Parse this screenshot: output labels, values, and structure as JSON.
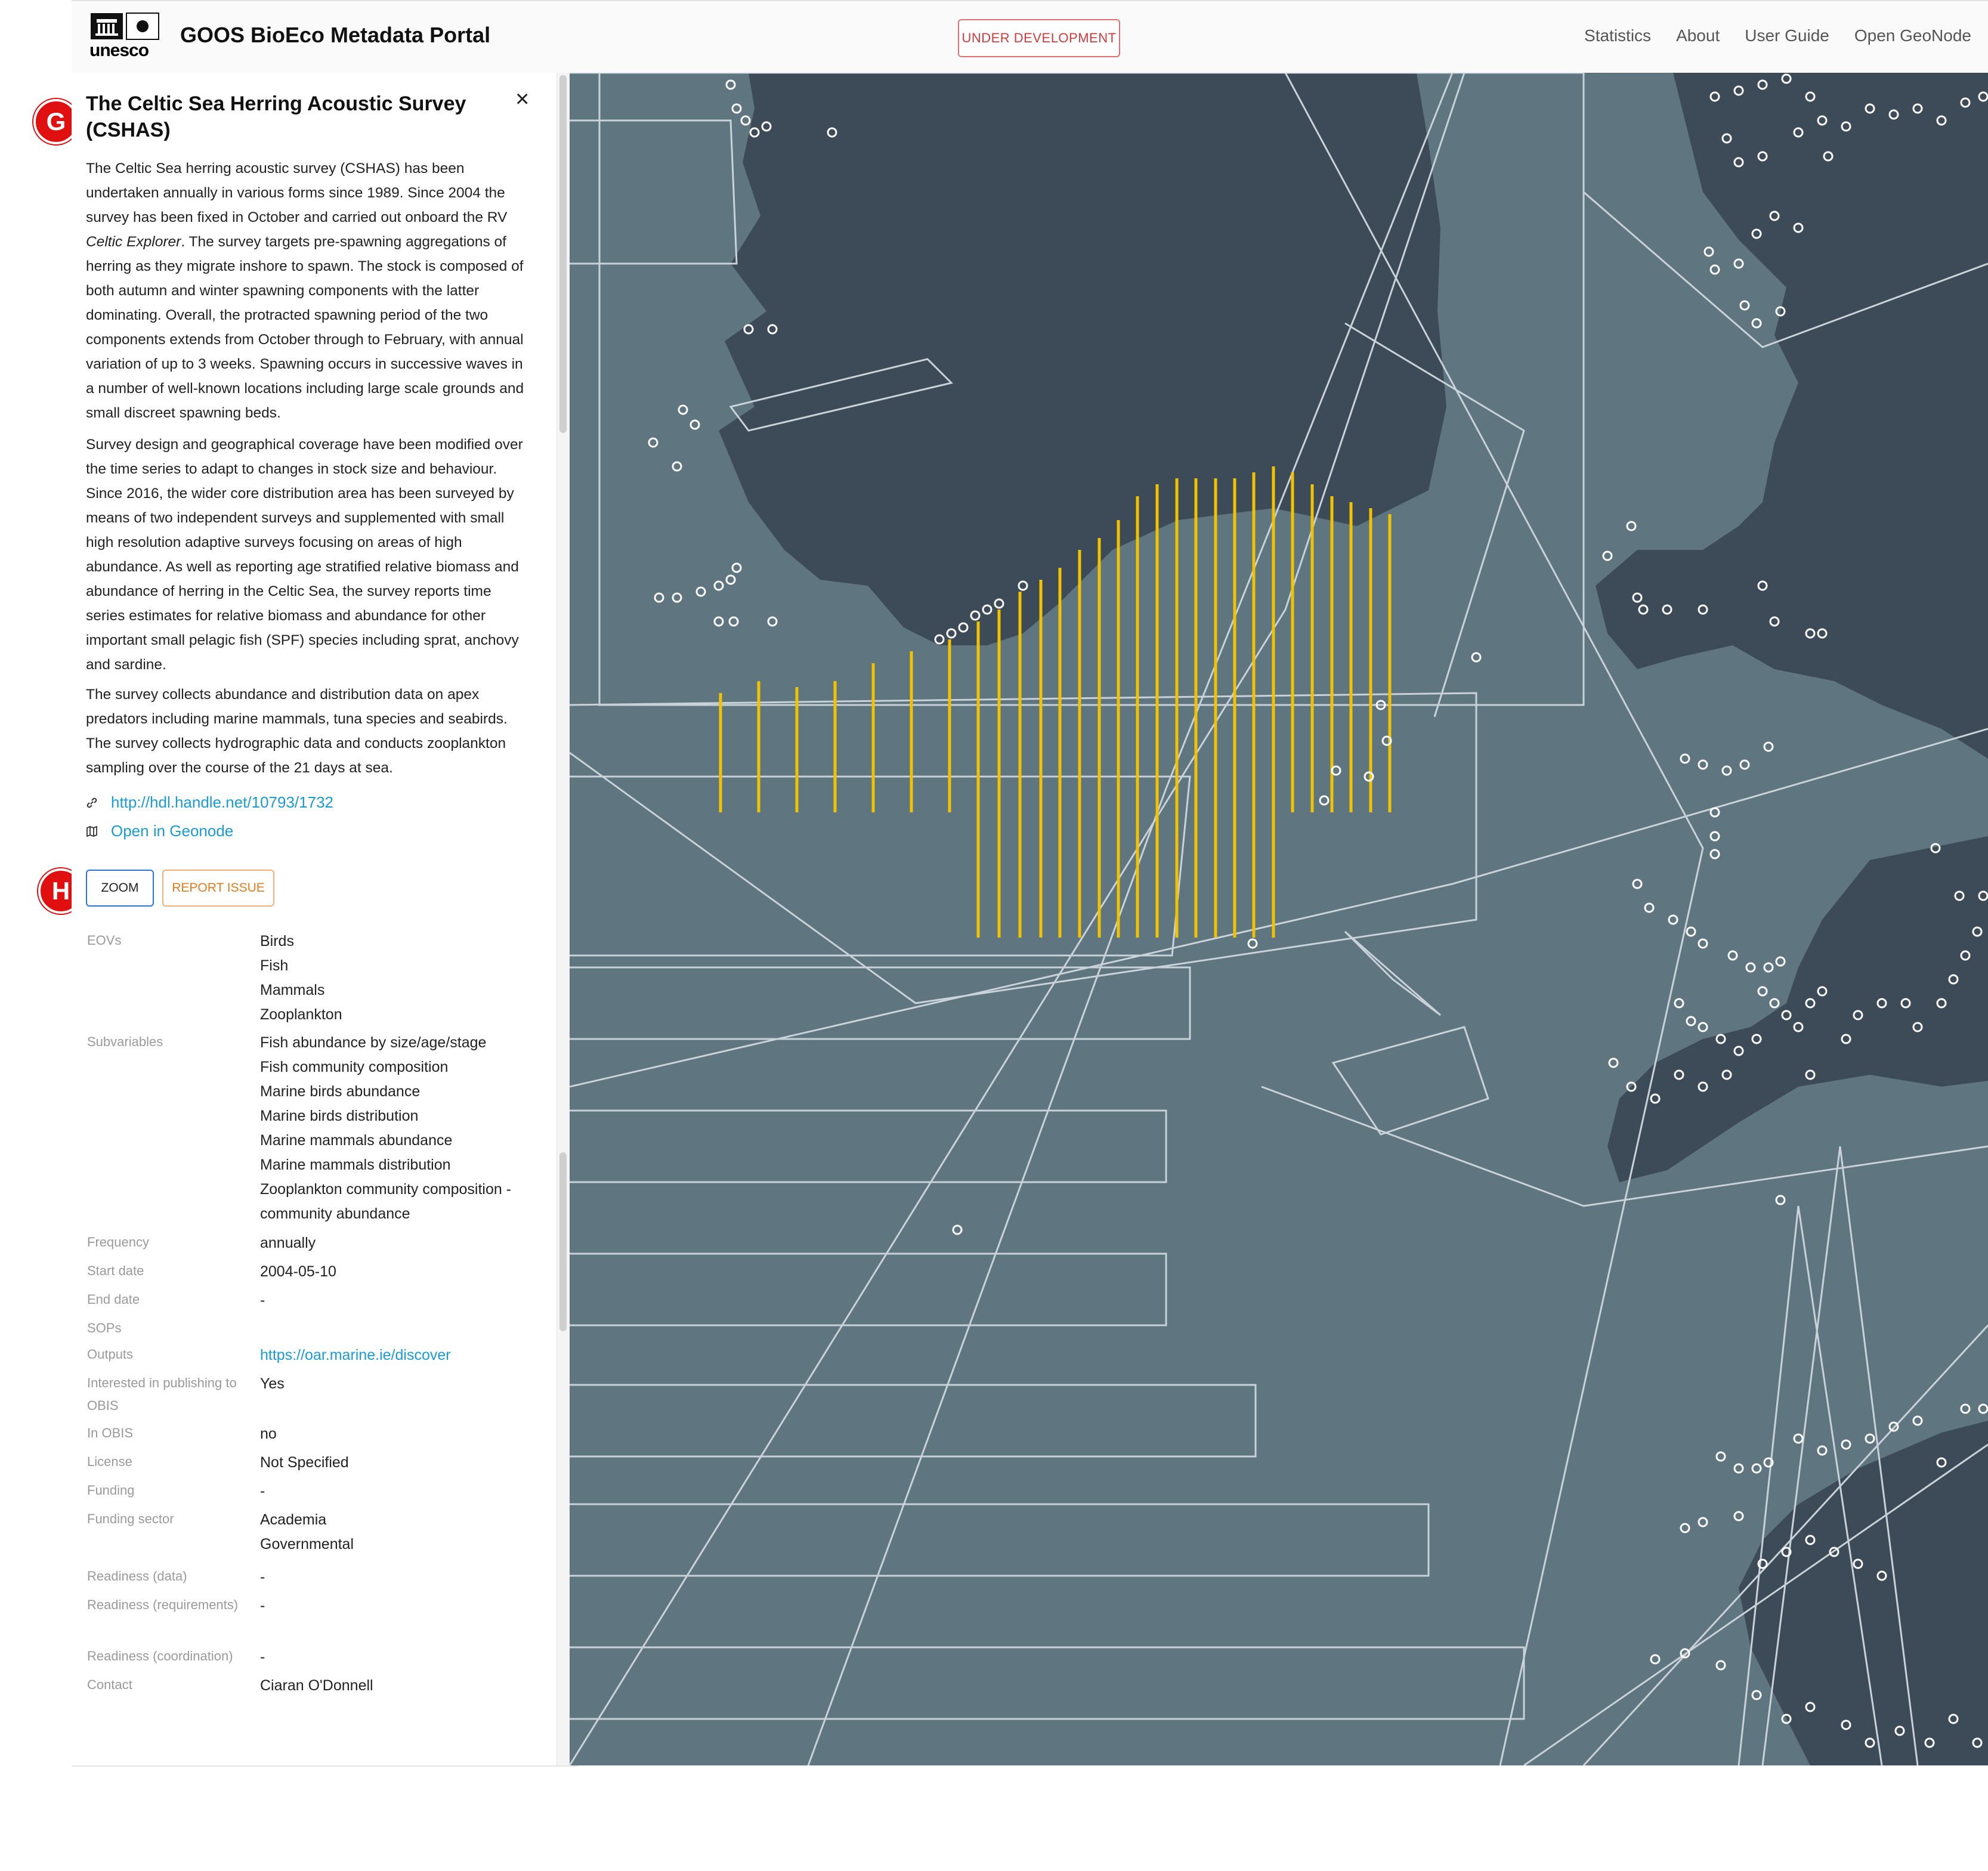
{
  "header": {
    "logo_text": "unesco",
    "title": "GOOS BioEco Metadata Portal",
    "dev_badge": "UNDER DEVELOPMENT",
    "nav": [
      "Statistics",
      "About",
      "User Guide",
      "Open GeoNode"
    ]
  },
  "annotations": {
    "g": "G",
    "h": "H"
  },
  "panel": {
    "title": "The Celtic Sea Herring Acoustic Survey (CSHAS)",
    "close": "×",
    "para1_a": "The Celtic Sea herring acoustic survey (CSHAS) has been undertaken annually in various forms since 1989. Since 2004 the survey has been fixed in October and carried out onboard the RV ",
    "para1_em": "Celtic Explorer",
    "para1_b": ". The survey targets pre-spawning aggregations of herring as they migrate inshore to spawn.  The stock is composed of both autumn and winter spawning components with the latter dominating. Overall, the protracted spawning period of the two components extends from October through to February, with annual variation of up to 3 weeks. Spawning occurs in successive waves in a number of well-known locations including large scale grounds and small discreet spawning beds.",
    "para2": "Survey design and geographical coverage have been modified over the time series to adapt to changes in stock size and behaviour. Since 2016, the wider core distribution area has been surveyed by means of two independent surveys and supplemented with small high resolution adaptive surveys focusing on areas of high abundance.  As well as reporting age stratified relative biomass and abundance of herring in the Celtic Sea, the survey reports time series estimates for relative biomass and abundance for other important small pelagic fish (SPF) species including sprat, anchovy and sardine.",
    "para3": "The survey collects abundance and distribution data on apex predators including marine mammals, tuna species and seabirds. The survey collects hydrographic data and conducts zooplankton sampling over the course of the 21 days at sea.",
    "link_handle": "http://hdl.handle.net/10793/1732",
    "link_geonode": "Open in Geonode",
    "zoom_label": "ZOOM",
    "report_label": "REPORT ISSUE",
    "meta": {
      "eovs_label": "EOVs",
      "eovs": "Birds\nFish\nMammals\nZooplankton",
      "subvariables_label": "Subvariables",
      "subvariables": "Fish abundance by size/age/stage\nFish community composition\nMarine birds abundance\nMarine birds distribution\nMarine mammals abundance\nMarine mammals distribution\nZooplankton community composition - community abundance",
      "frequency_label": "Frequency",
      "frequency": "annually",
      "start_label": "Start date",
      "start": "2004-05-10",
      "end_label": "End date",
      "end": "-",
      "sops_label": "SOPs",
      "outputs_label": "Outputs",
      "outputs": "https://oar.marine.ie/discover",
      "obis_interest_label": "Interested in publishing to OBIS",
      "obis_interest": "Yes",
      "in_obis_label": "In OBIS",
      "in_obis": "no",
      "license_label": "License",
      "license": "Not Specified",
      "funding_label": "Funding",
      "funding": "-",
      "funding_sector_label": "Funding sector",
      "funding_sector": "Academia\nGovernmental",
      "readiness_data_label": "Readiness (data)",
      "readiness_data": "-",
      "readiness_req_label": "Readiness (requirements)",
      "readiness_req": "-",
      "readiness_coord_label": "Readiness (coordination)",
      "readiness_coord": "-",
      "contact_label": "Contact",
      "contact": "Ciaran O'Donnell"
    }
  },
  "colors": {
    "sea": "#5f7580",
    "land": "#3d4a57",
    "track": "#f2c200",
    "outline": "#c9d2d8",
    "link": "#1a9bd6",
    "dev": "#d03a3a",
    "report": "#e47b1c",
    "zoom_border": "#2a74d6",
    "badge": "#e01010"
  }
}
